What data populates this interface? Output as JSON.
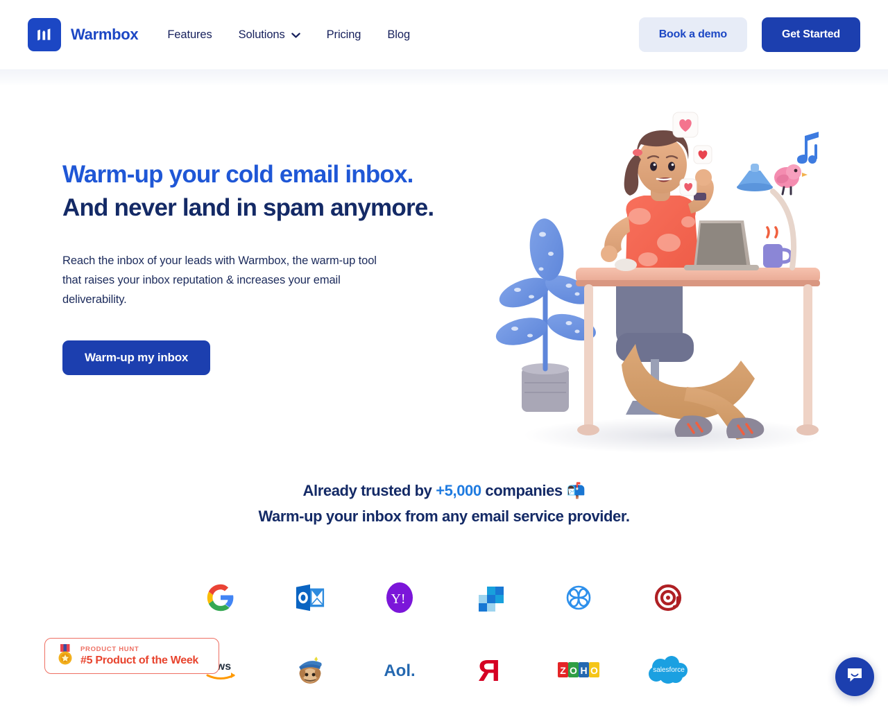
{
  "header": {
    "brand": {
      "name": "Warmbox",
      "logo_icon": "warmbox-logo-icon"
    },
    "nav": [
      {
        "label": "Features",
        "has_caret": false
      },
      {
        "label": "Solutions",
        "has_caret": true
      },
      {
        "label": "Pricing",
        "has_caret": false
      },
      {
        "label": "Blog",
        "has_caret": false
      }
    ],
    "actions": {
      "demo_label": "Book a demo",
      "start_label": "Get Started"
    }
  },
  "hero": {
    "headline_line1": "Warm-up your cold email inbox.",
    "headline_line2": "And never land in spam anymore.",
    "subtext": "Reach the inbox of your leads with Warmbox, the warm-up tool that raises your inbox reputation & increases your email deliverability.",
    "cta_label": "Warm-up my inbox",
    "illustration": "woman-at-desk-with-laptop-illustration"
  },
  "trust": {
    "line1_prefix": "Already trusted by ",
    "line1_highlight": "+5,000",
    "line1_suffix": " companies ",
    "line1_emoji": "📬",
    "line2": "Warm-up your inbox from any email service provider.",
    "providers_row1": [
      {
        "name": "Google",
        "icon": "google-logo-icon"
      },
      {
        "name": "Outlook",
        "icon": "outlook-logo-icon"
      },
      {
        "name": "Yahoo",
        "icon": "yahoo-logo-icon"
      },
      {
        "name": "Microsoft 365",
        "icon": "microsoft365-logo-icon"
      },
      {
        "name": "Sendinblue",
        "icon": "sendinblue-logo-icon"
      },
      {
        "name": "Mailgun",
        "icon": "mailgun-logo-icon"
      }
    ],
    "providers_row2": [
      {
        "name": "Amazon Web Services",
        "icon": "aws-logo-icon"
      },
      {
        "name": "Mailchimp",
        "icon": "mailchimp-logo-icon"
      },
      {
        "name": "Aol.",
        "icon": "aol-logo-icon"
      },
      {
        "name": "Yandex",
        "icon": "yandex-logo-icon"
      },
      {
        "name": "Zoho",
        "icon": "zoho-logo-icon"
      },
      {
        "name": "Salesforce",
        "icon": "salesforce-logo-icon"
      }
    ]
  },
  "product_hunt_badge": {
    "kicker": "PRODUCT HUNT",
    "title": "#5 Product of the Week",
    "medal_icon": "medal-icon"
  },
  "chat": {
    "launcher_icon": "chat-bubble-icon"
  },
  "colors": {
    "brand_blue": "#1C47C4",
    "button_blue": "#1C3FAF",
    "demo_button_bg": "#E7ECF7",
    "headline_blue": "#1F57D6",
    "headline_navy": "#142A66",
    "highlight_blue": "#1F7BE0",
    "product_hunt_red": "#E8442E"
  }
}
